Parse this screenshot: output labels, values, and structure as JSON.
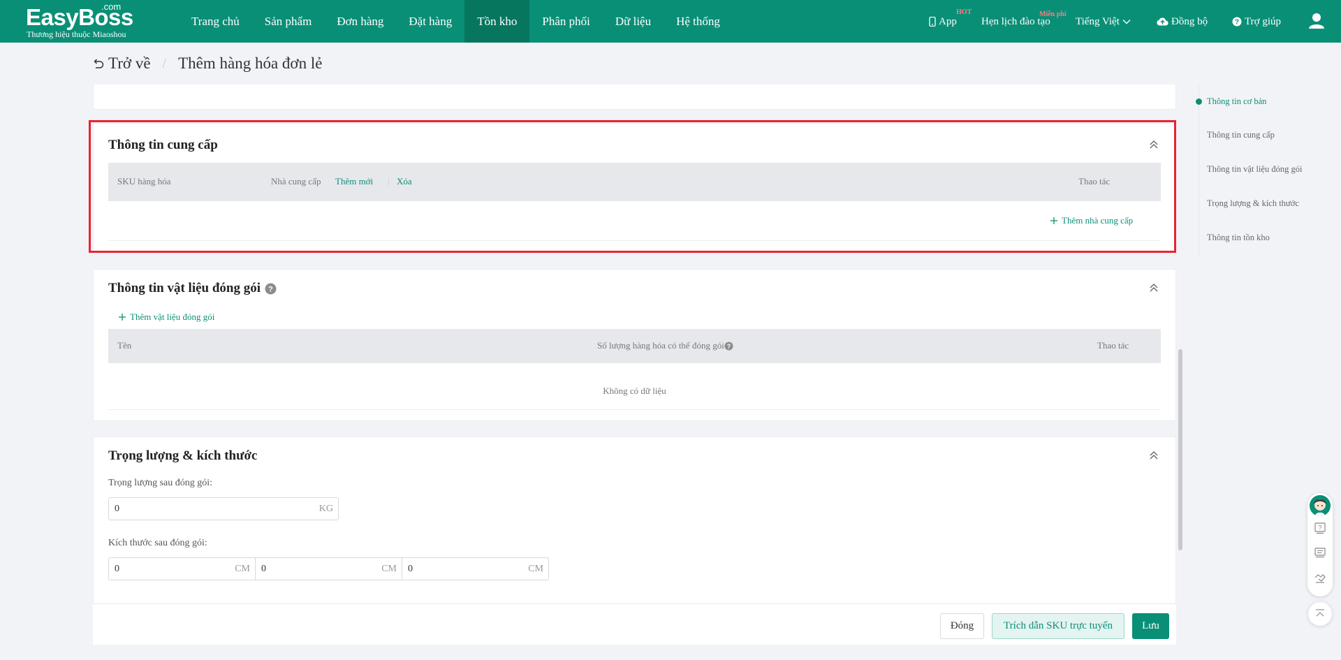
{
  "brand": {
    "name": "EasyBoss",
    "domain_suffix": ".com",
    "tagline": "Thương hiệu thuộc Miaoshou"
  },
  "nav": {
    "items": [
      {
        "label": "Trang chủ"
      },
      {
        "label": "Sản phẩm"
      },
      {
        "label": "Đơn hàng"
      },
      {
        "label": "Đặt hàng"
      },
      {
        "label": "Tồn kho",
        "active": true
      },
      {
        "label": "Phân phối"
      },
      {
        "label": "Dữ liệu"
      },
      {
        "label": "Hệ thống"
      }
    ],
    "app_label": "App",
    "app_badge": "HOT",
    "training_label": "Hẹn lịch đào tạo",
    "training_badge": "Miễn phí",
    "language_label": "Tiếng Việt",
    "sync_label": "Đồng bộ",
    "help_label": "Trợ giúp"
  },
  "breadcrumb": {
    "back_label": "Trở về",
    "current": "Thêm hàng hóa đơn lẻ"
  },
  "supply": {
    "title": "Thông tin cung cấp",
    "col_sku": "SKU hàng hóa",
    "col_supplier": "Nhà cung cấp",
    "add_new": "Thêm mới",
    "delete": "Xóa",
    "col_action": "Thao tác",
    "add_supplier": "Thêm nhà cung cấp"
  },
  "packaging": {
    "title": "Thông tin vật liệu đóng gói",
    "add_material": "Thêm vật liệu đóng gói",
    "col_name": "Tên",
    "col_quantity": "Số lượng hàng hóa có thể đóng gói",
    "col_action": "Thao tác",
    "empty": "Không có dữ liệu"
  },
  "weight": {
    "title": "Trọng lượng & kích thước",
    "weight_label": "Trọng lượng sau đóng gói:",
    "weight_value": "0",
    "weight_unit": "KG",
    "size_label": "Kích thước sau đóng gói:",
    "length_value": "0",
    "width_value": "0",
    "height_value": "0",
    "size_unit": "CM"
  },
  "anchor_nav": {
    "items": [
      {
        "label": "Thông tin cơ bản",
        "active": true
      },
      {
        "label": "Thông tin cung cấp"
      },
      {
        "label": "Thông tin vật liệu đóng gói"
      },
      {
        "label": "Trọng lượng & kích thước"
      },
      {
        "label": "Thông tin tồn kho"
      }
    ]
  },
  "footer": {
    "close_label": "Đóng",
    "cite_label": "Trích dẫn SKU trực tuyến",
    "save_label": "Lưu"
  },
  "colors": {
    "brand": "#0a8f77",
    "brand_dark": "#06765f",
    "highlight": "#e8242f",
    "hot": "#ff7b7b"
  }
}
